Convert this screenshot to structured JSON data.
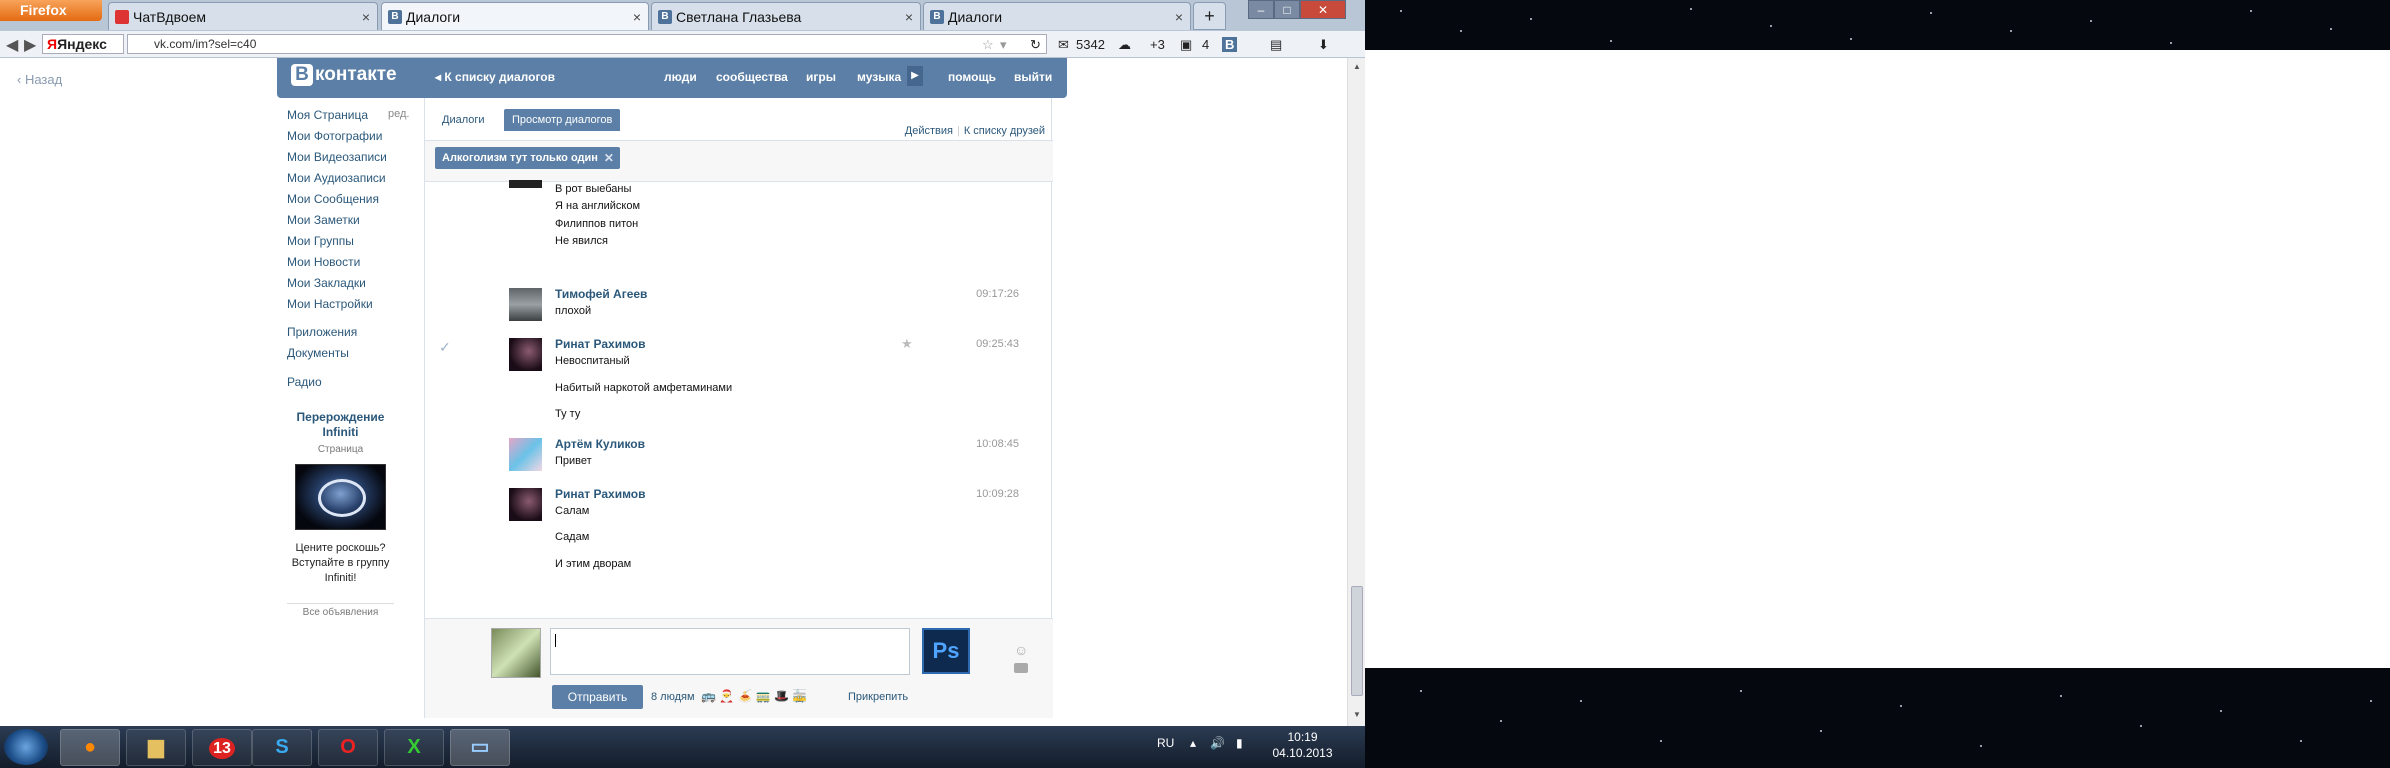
{
  "browser": {
    "app_button": "Firefox",
    "tabs": [
      {
        "icon": "chat-icon",
        "title": "ЧатВдвоем"
      },
      {
        "icon": "vk-icon",
        "title": "Диалоги"
      },
      {
        "icon": "vk-icon",
        "title": "Светлана Глазьева"
      },
      {
        "icon": "vk-icon",
        "title": "Диалоги"
      }
    ],
    "new_tab": "+",
    "search_engine": "Яндекс",
    "url": "vk.com/im?sel=c40",
    "toolbar": {
      "mail_count": "5342",
      "weather": "+3",
      "notes": "4"
    }
  },
  "page": {
    "back_link": "Назад",
    "header": {
      "logo": "контакте",
      "logo_badge": "В",
      "back_to_dialogs": "К списку диалогов",
      "links": [
        "люди",
        "сообщества",
        "игры",
        "музыка",
        "помощь",
        "выйти"
      ]
    },
    "sidebar": {
      "edit": "ред.",
      "items": [
        "Моя Страница",
        "Мои Фотографии",
        "Мои Видеозаписи",
        "Мои Аудиозаписи",
        "Мои Сообщения",
        "Мои Заметки",
        "Мои Группы",
        "Мои Новости",
        "Мои Закладки",
        "Мои Настройки"
      ],
      "extra": [
        "Приложения",
        "Документы"
      ],
      "radio": "Радио"
    },
    "ad": {
      "title": "Перерождение Infiniti",
      "subtitle": "Страница",
      "text": "Цените роскошь? Вступайте в группу Infiniti!",
      "all_ads": "Все объявления"
    },
    "tabs": [
      "Диалоги",
      "Просмотр диалогов"
    ],
    "actions": [
      "Действия",
      "К списку друзей"
    ],
    "chip": "Алкоголизм тут только один",
    "messages": [
      {
        "author": "",
        "time": "",
        "lines": [
          "В рот выебаны",
          "Я на английском",
          "Филиппов питон",
          "Не явился"
        ]
      },
      {
        "author": "Тимофей Агеев",
        "time": "09:17:26",
        "lines": [
          "плохой"
        ]
      },
      {
        "author": "Ринат Рахимов",
        "time": "09:25:43",
        "lines": [
          "Невоспитаный",
          "Набитый наркотой амфетаминами",
          "Ту ту"
        ]
      },
      {
        "author": "Артём Куликов",
        "time": "10:08:45",
        "lines": [
          "Привет"
        ]
      },
      {
        "author": "Ринат Рахимов",
        "time": "10:09:28",
        "lines": [
          "Салам",
          "Садам",
          "И этим дворам"
        ]
      }
    ],
    "composer": {
      "send": "Отправить",
      "people": "8 людям",
      "attach": "Прикрепить",
      "ps_label": "Ps"
    }
  },
  "taskbar": {
    "lang": "RU",
    "time": "10:19",
    "date": "04.10.2013",
    "apps": [
      "firefox-icon",
      "explorer-icon",
      "13-icon",
      "skype-icon",
      "opera-icon",
      "excel-icon",
      "window-icon"
    ],
    "app13": "13"
  },
  "colors": {
    "vk_blue": "#5b7fa6",
    "link": "#2b587a"
  }
}
